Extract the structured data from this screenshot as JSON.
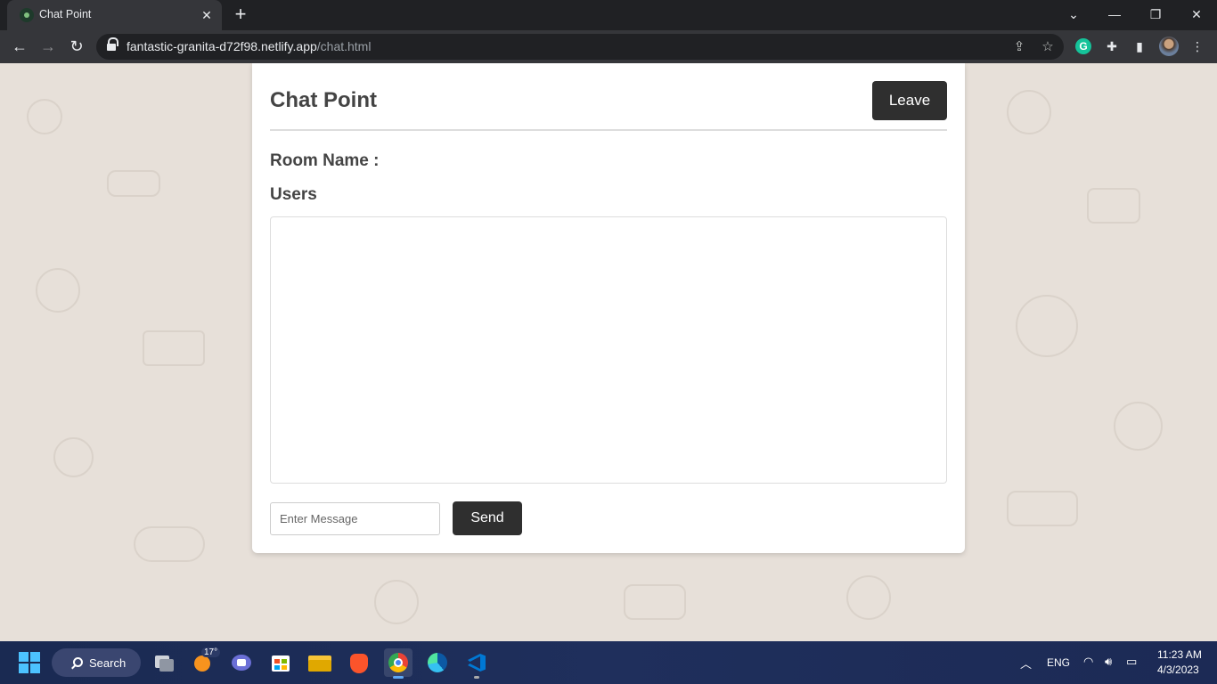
{
  "browser": {
    "tab_title": "Chat Point",
    "tab_close": "✕",
    "new_tab": "+",
    "url_host": "fantastic-granita-d72f98.netlify.app",
    "url_path": "/chat.html",
    "window_controls": {
      "dropdown": "⌄",
      "minimize": "—",
      "restore": "❐",
      "close": "✕"
    },
    "nav": {
      "back": "←",
      "forward": "→",
      "reload": "↻"
    },
    "icons": [
      "share-icon",
      "bookmark-star-icon",
      "grammarly-icon",
      "extensions-icon",
      "side-panel-icon",
      "profile-avatar",
      "menu-dots-icon"
    ],
    "grammarly_letter": "G"
  },
  "page": {
    "brand": "Chat Point",
    "leave_label": "Leave",
    "room_name_label": "Room Name :",
    "users_label": "Users",
    "message_placeholder": "Enter Message",
    "send_label": "Send"
  },
  "taskbar": {
    "search_label": "Search",
    "weather_temp": "17°",
    "language": "ENG",
    "time": "11:23 AM",
    "date": "4/3/2023",
    "apps": [
      "task-view-icon",
      "weather-icon",
      "teams-meet-icon",
      "microsoft-store-icon",
      "file-explorer-icon",
      "brave-icon",
      "chrome-icon",
      "edge-icon",
      "vscode-icon"
    ]
  },
  "colors": {
    "page_background": "#e7e0d9",
    "button_dark": "#2f2f2f",
    "heading_text": "#444444",
    "browser_frame": "#202124",
    "toolbar": "#35363a"
  }
}
